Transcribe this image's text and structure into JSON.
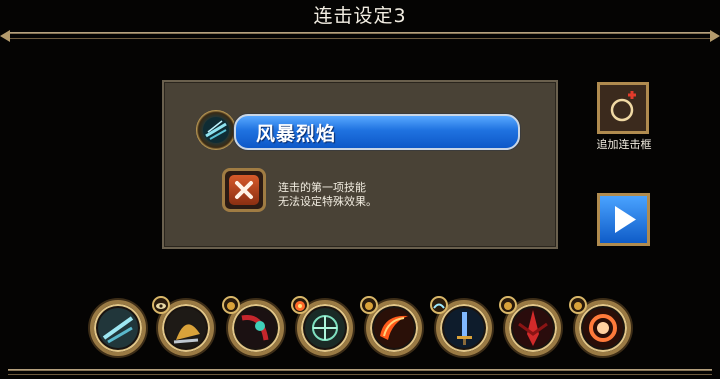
{
  "header": {
    "title": "连击设定3"
  },
  "combo_panel": {
    "skill_name": "风暴烈焰",
    "description_line1": "连击的第一项技能",
    "description_line2": "无法设定特殊效果。"
  },
  "side": {
    "add_combo_label": "追加连击框"
  },
  "skills": [
    {
      "icon": "storm-drill-icon",
      "badge": null
    },
    {
      "icon": "golden-shield-icon",
      "badge": "eye-badge-icon"
    },
    {
      "icon": "red-slash-icon",
      "badge": "gold-badge-icon"
    },
    {
      "icon": "green-aura-icon",
      "badge": "burst-badge-icon"
    },
    {
      "icon": "fire-crescent-icon",
      "badge": "gold-badge-icon"
    },
    {
      "icon": "blue-sword-icon",
      "badge": "wing-badge-icon"
    },
    {
      "icon": "crimson-blade-icon",
      "badge": "gold-badge-icon"
    },
    {
      "icon": "flame-ring-icon",
      "badge": "gold-badge-icon"
    }
  ],
  "colors": {
    "skillbar": "#1f72e0",
    "gold": "#b08b4f",
    "panel": "#494236"
  }
}
